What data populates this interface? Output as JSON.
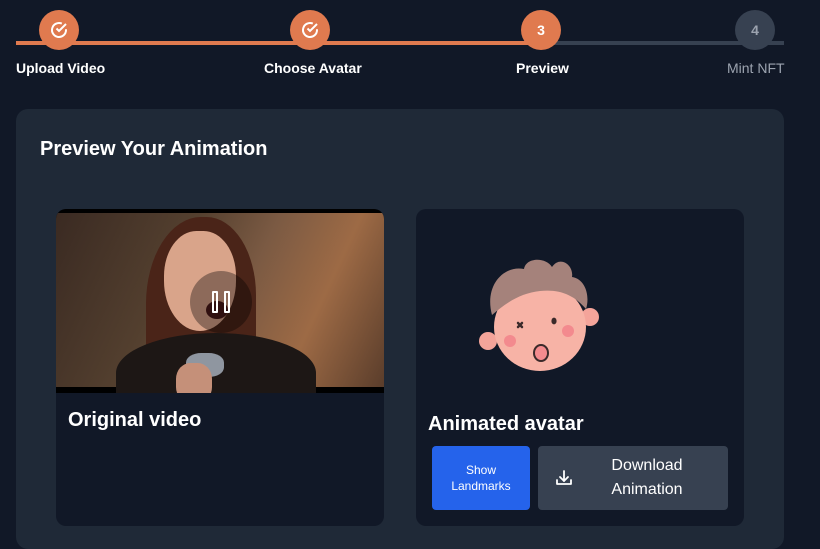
{
  "stepper": {
    "steps": [
      {
        "label": "Upload Video",
        "state": "done",
        "number": ""
      },
      {
        "label": "Choose Avatar",
        "state": "done",
        "number": ""
      },
      {
        "label": "Preview",
        "state": "active",
        "number": "3"
      },
      {
        "label": "Mint NFT",
        "state": "pending",
        "number": "4"
      }
    ]
  },
  "panel": {
    "title": "Preview Your Animation"
  },
  "original_card": {
    "label": "Original video",
    "icon": "pause-icon"
  },
  "avatar_card": {
    "label": "Animated avatar",
    "show_landmarks_label": "Show Landmarks",
    "download_label": "Download Animation",
    "download_icon": "download-icon"
  },
  "colors": {
    "accent": "#e07a4f",
    "primary_button": "#2563eb",
    "background": "#111827",
    "panel": "#1f2937"
  }
}
